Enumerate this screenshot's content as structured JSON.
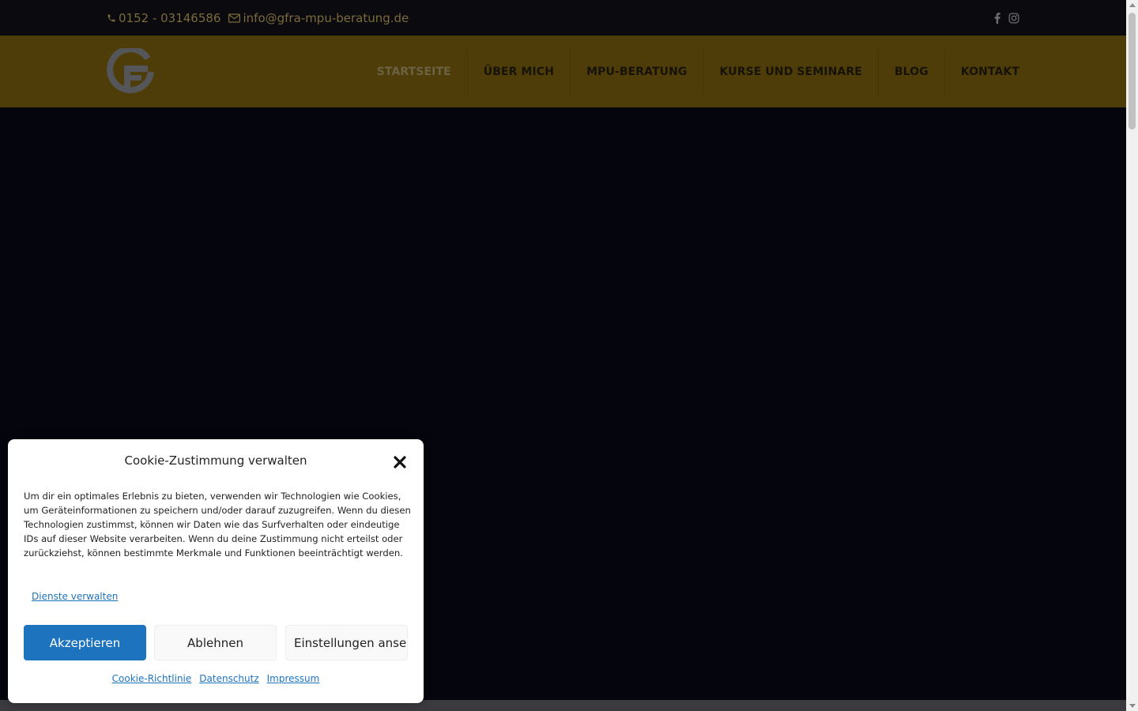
{
  "topbar": {
    "phone": "0152 - 03146586",
    "email": "info@gfra-mpu-beratung.de",
    "social": [
      "facebook-icon",
      "instagram-icon"
    ]
  },
  "nav": {
    "items": [
      {
        "label": "STARTSEITE",
        "active": true
      },
      {
        "label": "ÜBER MICH"
      },
      {
        "label": "MPU-BERATUNG"
      },
      {
        "label": "KURSE UND SEMINARE"
      },
      {
        "label": "BLOG"
      },
      {
        "label": "KONTAKT"
      }
    ]
  },
  "cookie": {
    "title": "Cookie-Zustimmung verwalten",
    "message": "Um dir ein optimales Erlebnis zu bieten, verwenden wir Technologien wie Cookies, um Geräteinformationen zu speichern und/oder darauf zuzugreifen. Wenn du diesen Technologien zustimmst, können wir Daten wie das Surfverhalten oder eindeutige IDs auf dieser Website verarbeiten. Wenn du deine Zustimmung nicht erteilst oder zurückziehst, können bestimmte Merkmale und Funktionen beeinträchtigt werden.",
    "manage_link": "Dienste verwalten",
    "accept": "Akzeptieren",
    "deny": "Ablehnen",
    "preferences": "Einstellungen ansehen",
    "links": [
      "Cookie-Richtlinie",
      "Datenschutz",
      "Impressum"
    ]
  },
  "colors": {
    "header": "#4f3d09",
    "topbar": "#0a0a0f",
    "hero": "#05050e",
    "accent_blue": "#1e73be"
  }
}
